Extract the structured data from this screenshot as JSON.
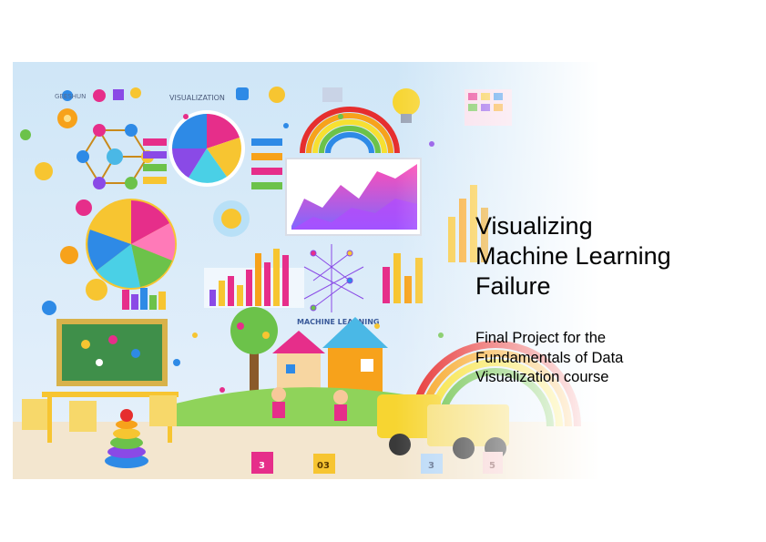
{
  "slide": {
    "title_lines": [
      "Visualizing",
      "Machine Learning",
      "Failure"
    ],
    "subtitle_lines": [
      "Final Project for the",
      "Fundamentals of Data",
      "Visualization course"
    ]
  },
  "illustration": {
    "banner_top": "VISUALIZATION",
    "banner_center": "MACHINE LEARNING",
    "corner_label": "GEESHUN",
    "blocks": [
      "3",
      "03",
      "3",
      "5"
    ]
  },
  "colors": {
    "accent_pink": "#e62e8a",
    "accent_yellow": "#f7c531",
    "accent_blue": "#2e8ae6",
    "accent_green": "#6cc24a",
    "accent_purple": "#8a4ae6"
  }
}
